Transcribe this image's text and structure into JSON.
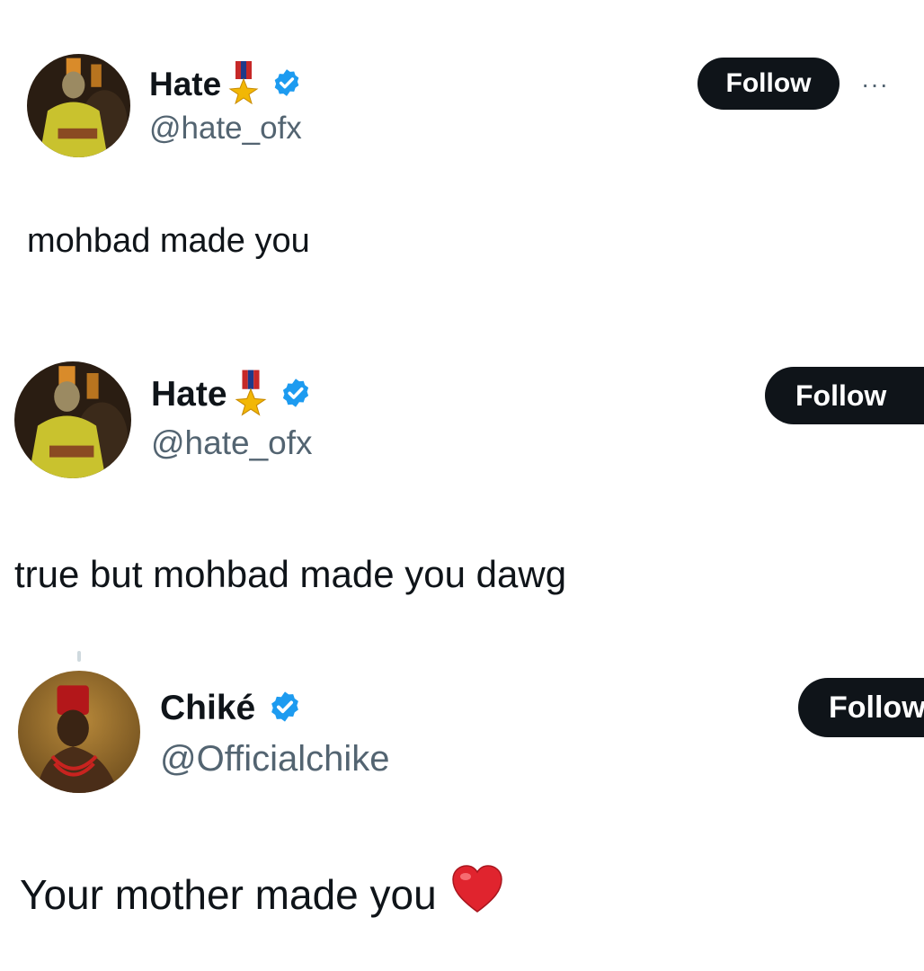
{
  "tweets": [
    {
      "name": "Hate",
      "handle": "@hate_ofx",
      "verified": true,
      "badge": "military-medal",
      "follow_label": "Follow",
      "has_more": true,
      "text": "mohbad made you"
    },
    {
      "name": "Hate",
      "handle": "@hate_ofx",
      "verified": true,
      "badge": "military-medal",
      "follow_label": "Follow",
      "text": "true but mohbad made you dawg"
    },
    {
      "name": "Chiké",
      "handle": "@Officialchike",
      "verified": true,
      "follow_label": "Follow",
      "text": "Your mother made you",
      "emoji": "red-heart"
    }
  ],
  "more_label": "···",
  "colors": {
    "verified": "#1d9bf0",
    "button": "#0f1419",
    "handle": "#536471"
  }
}
